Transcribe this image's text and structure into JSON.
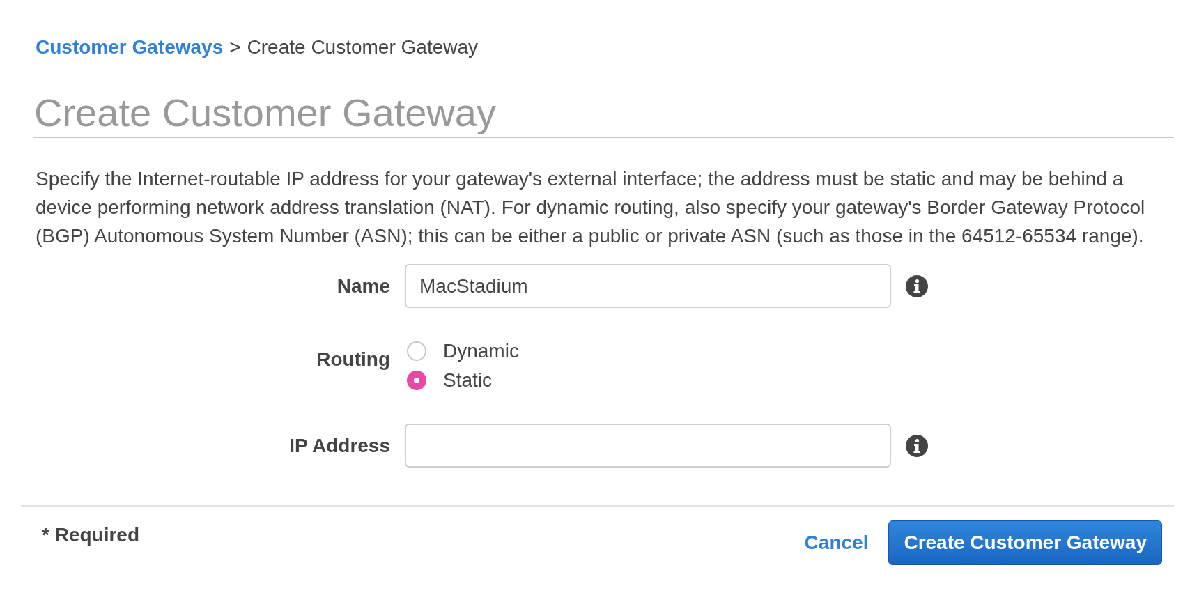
{
  "breadcrumb": {
    "link": "Customer Gateways",
    "separator": ">",
    "current": "Create Customer Gateway"
  },
  "title": "Create Customer Gateway",
  "description": "Specify the Internet-routable IP address for your gateway's external interface; the address must be static and may be behind a device performing network address translation (NAT). For dynamic routing, also specify your gateway's Border Gateway Protocol (BGP) Autonomous System Number (ASN); this can be either a public or private ASN (such as those in the 64512-65534 range).",
  "form": {
    "fields": [
      {
        "kind": "text",
        "label": "Name",
        "value": "MacStadium",
        "info": true
      },
      {
        "kind": "radio",
        "label": "Routing",
        "options": [
          {
            "label": "Dynamic",
            "selected": false
          },
          {
            "label": "Static",
            "selected": true
          }
        ]
      },
      {
        "kind": "text",
        "label": "IP Address",
        "info": true
      }
    ]
  },
  "footer": {
    "required_note": "* Required",
    "cancel": "Cancel",
    "submit": "Create Customer Gateway"
  }
}
